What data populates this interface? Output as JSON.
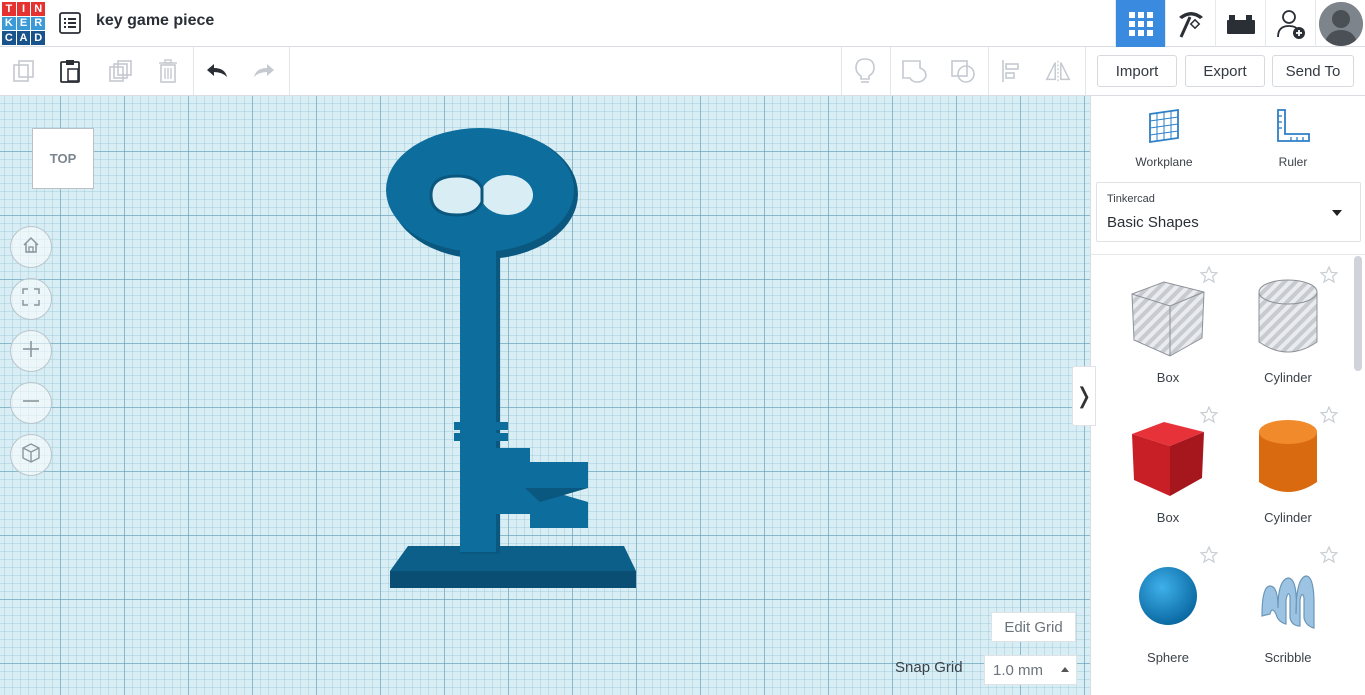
{
  "app": {
    "logo_letters": [
      "T",
      "I",
      "N",
      "K",
      "E",
      "R",
      "C",
      "A",
      "D"
    ],
    "logo_colors": [
      "#e5312f",
      "#e5312f",
      "#e5312f",
      "#3c9ad6",
      "#3c9ad6",
      "#3c9ad6",
      "#19538b",
      "#19538b",
      "#19538b"
    ],
    "design_title": "key game piece"
  },
  "topbar": {
    "icons": [
      "grid-3d-view-icon",
      "pickaxe-icon",
      "brick-icon",
      "add-user-icon",
      "user-avatar"
    ]
  },
  "toolbar": {
    "buttons": [
      "copy-icon",
      "paste-icon",
      "duplicate-icon",
      "delete-icon",
      "undo-icon",
      "redo-icon",
      "note-icon",
      "group-icon",
      "ungroup-icon",
      "align-icon",
      "mirror-icon"
    ],
    "import_label": "Import",
    "export_label": "Export",
    "send_to_label": "Send To"
  },
  "workspace": {
    "view_cube_label": "TOP",
    "nav_buttons": [
      "home-icon",
      "fit-view-icon",
      "zoom-in-icon",
      "zoom-out-icon",
      "perspective-icon"
    ],
    "edit_grid_label": "Edit Grid",
    "snap_grid_label": "Snap Grid",
    "snap_grid_value": "1.0 mm",
    "model_color": "#0d6d9c"
  },
  "panel": {
    "workplane_label": "Workplane",
    "ruler_label": "Ruler",
    "library_source": "Tinkercad",
    "library_name": "Basic Shapes",
    "shapes": [
      {
        "name": "Box",
        "style": "hole",
        "color": "#bfc3c8"
      },
      {
        "name": "Cylinder",
        "style": "hole",
        "color": "#bfc3c8"
      },
      {
        "name": "Box",
        "style": "solid",
        "color": "#d1232a"
      },
      {
        "name": "Cylinder",
        "style": "solid",
        "color": "#e77817"
      },
      {
        "name": "Sphere",
        "style": "solid",
        "color": "#1a8ed0"
      },
      {
        "name": "Scribble",
        "style": "solid",
        "color": "#8fb9d9"
      }
    ]
  },
  "collapse_panel_glyph": "❭"
}
